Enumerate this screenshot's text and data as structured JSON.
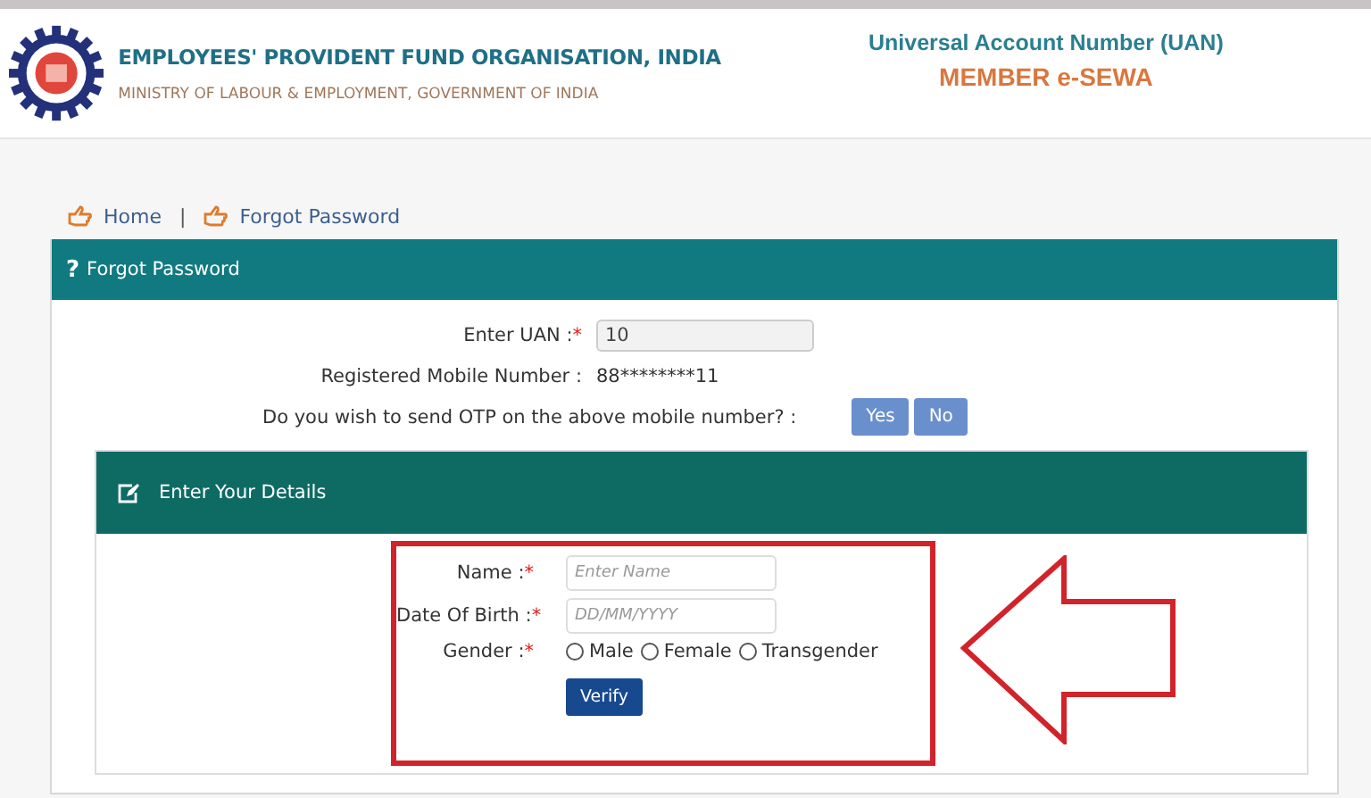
{
  "header": {
    "org_name": "EMPLOYEES' PROVIDENT FUND ORGANISATION, INDIA",
    "ministry": "MINISTRY OF LABOUR & EMPLOYMENT, GOVERNMENT OF INDIA",
    "portal_title": "Universal Account Number (UAN)",
    "portal_subtitle": "MEMBER e-SEWA"
  },
  "breadcrumb": {
    "separator": "|",
    "items": [
      {
        "label": "Home"
      },
      {
        "label": "Forgot Password"
      }
    ]
  },
  "panel": {
    "icon": "?",
    "title": "Forgot Password",
    "fields": [
      {
        "kind": "input",
        "label": "Enter UAN :",
        "required_mark": "*",
        "value": "10"
      },
      {
        "kind": "text",
        "label": "Registered Mobile Number :",
        "value": "88********11"
      }
    ],
    "otp_question": "Do you wish to send OTP on the above mobile number? :",
    "otp_buttons": [
      "Yes",
      "No"
    ],
    "details": {
      "title": "Enter Your Details",
      "fields": [
        {
          "kind": "input",
          "label": "Name :",
          "required_mark": "*",
          "placeholder": "Enter Name"
        },
        {
          "kind": "input",
          "label": "Date Of Birth :",
          "required_mark": "*",
          "placeholder": "DD/MM/YYYY"
        },
        {
          "kind": "radio",
          "label": "Gender :",
          "required_mark": "*",
          "options": [
            {
              "label": "Male",
              "selected": false
            },
            {
              "label": "Female",
              "selected": false
            },
            {
              "label": "Transgender",
              "selected": false
            }
          ]
        }
      ],
      "submit": "Verify"
    }
  }
}
